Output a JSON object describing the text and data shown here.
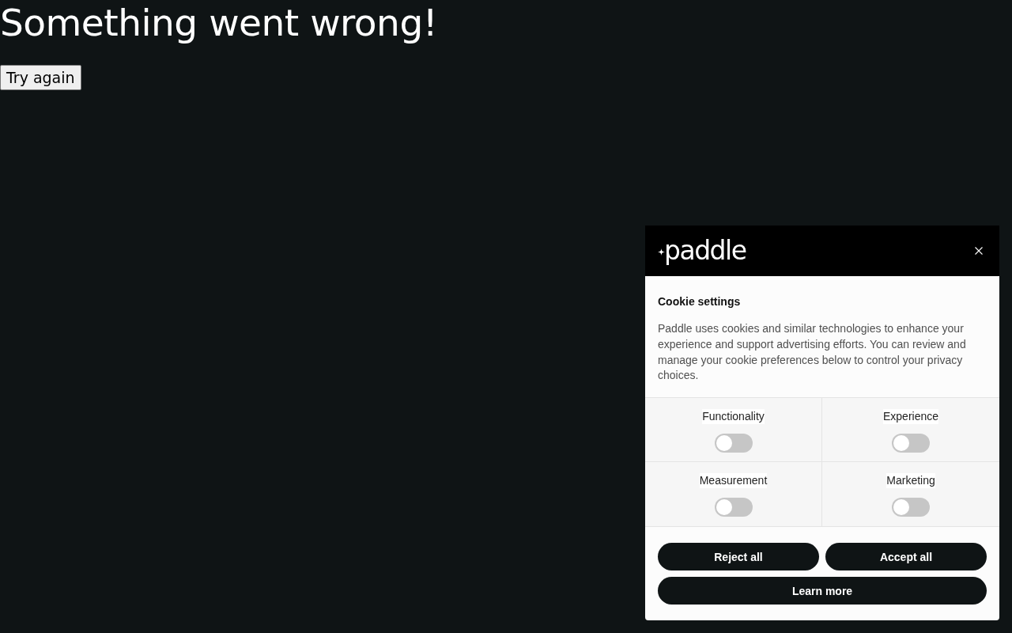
{
  "page": {
    "heading": "Something went wrong!",
    "retry_button": "Try again"
  },
  "cookie_dialog": {
    "logo": "paddle",
    "title": "Cookie settings",
    "description": "Paddle uses cookies and similar technologies to enhance your experience and support advertising efforts. You can review and manage your cookie preferences below to control your privacy choices.",
    "categories": [
      {
        "label": "Functionality",
        "on": false
      },
      {
        "label": "Experience",
        "on": false
      },
      {
        "label": "Measurement",
        "on": false
      },
      {
        "label": "Marketing",
        "on": false
      }
    ],
    "buttons": [
      "Reject all",
      "Accept all",
      "Learn more"
    ]
  }
}
